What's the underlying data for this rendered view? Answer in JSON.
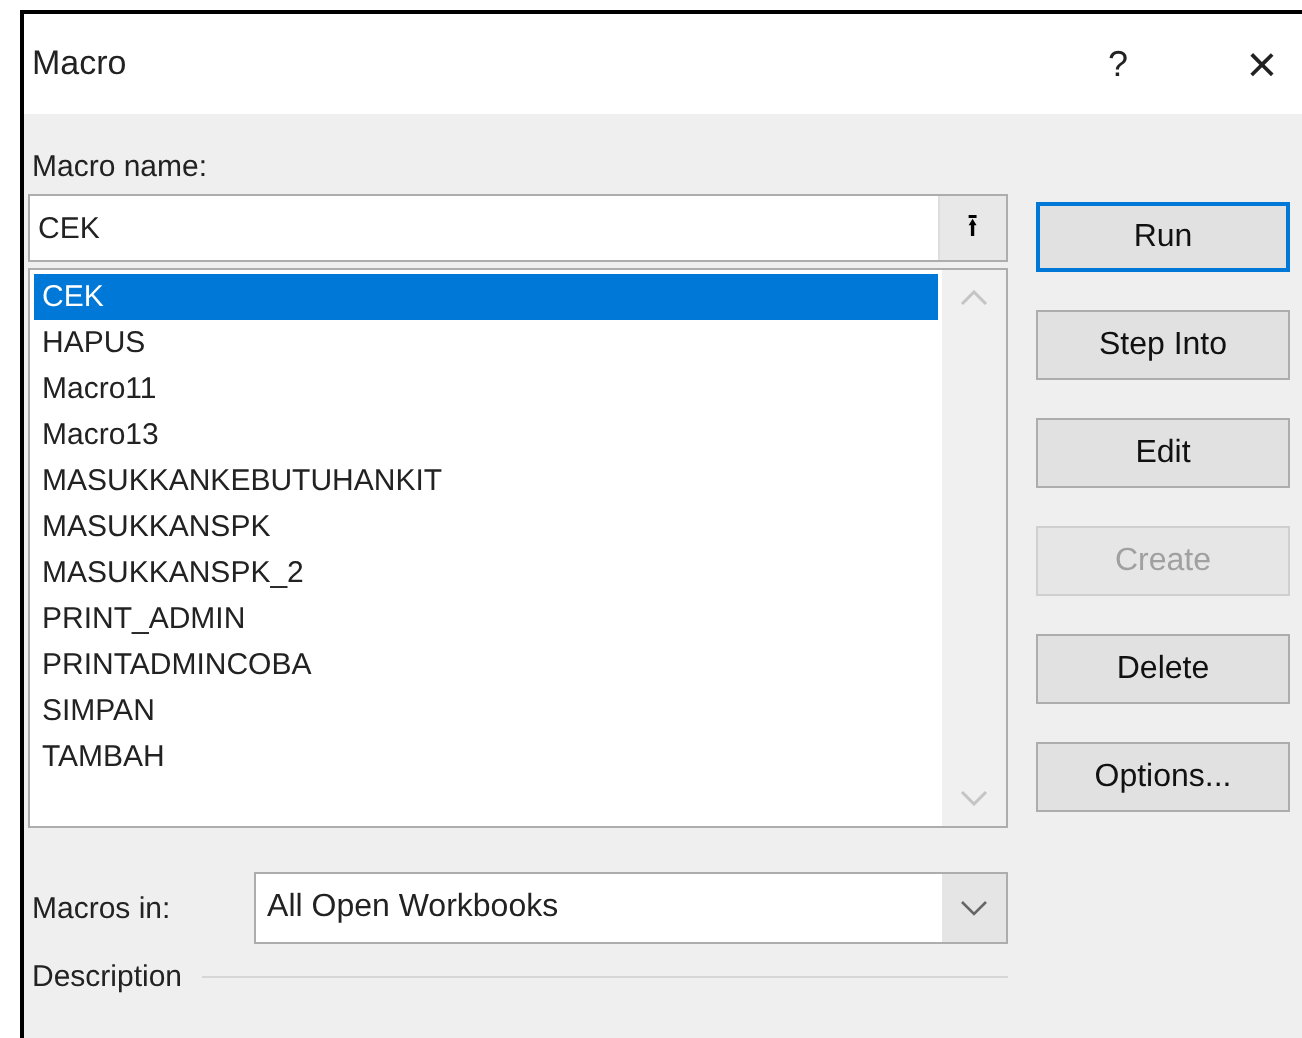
{
  "window": {
    "title": "Macro",
    "help": "?",
    "close": "×"
  },
  "macro_name": {
    "label": "Macro name:",
    "value": "CEK",
    "button": "⭱"
  },
  "macros": [
    {
      "name": "CEK",
      "selected": true
    },
    {
      "name": "HAPUS",
      "selected": false
    },
    {
      "name": "Macro11",
      "selected": false
    },
    {
      "name": "Macro13",
      "selected": false
    },
    {
      "name": "MASUKKANKEBUTUHANKIT",
      "selected": false
    },
    {
      "name": "MASUKKANSPK",
      "selected": false
    },
    {
      "name": "MASUKKANSPK_2",
      "selected": false
    },
    {
      "name": "PRINT_ADMIN",
      "selected": false
    },
    {
      "name": "PRINTADMINCOBA",
      "selected": false
    },
    {
      "name": "SIMPAN",
      "selected": false
    },
    {
      "name": "TAMBAH",
      "selected": false
    }
  ],
  "buttons": [
    {
      "label": "Run",
      "default": true,
      "disabled": false
    },
    {
      "label": "Step Into",
      "default": false,
      "disabled": false
    },
    {
      "label": "Edit",
      "default": false,
      "disabled": false
    },
    {
      "label": "Create",
      "default": false,
      "disabled": true
    },
    {
      "label": "Delete",
      "default": false,
      "disabled": false
    },
    {
      "label": "Options...",
      "default": false,
      "disabled": false
    }
  ],
  "macros_in": {
    "label": "Macros in:",
    "value": "All Open Workbooks"
  },
  "description": {
    "label": "Description"
  }
}
